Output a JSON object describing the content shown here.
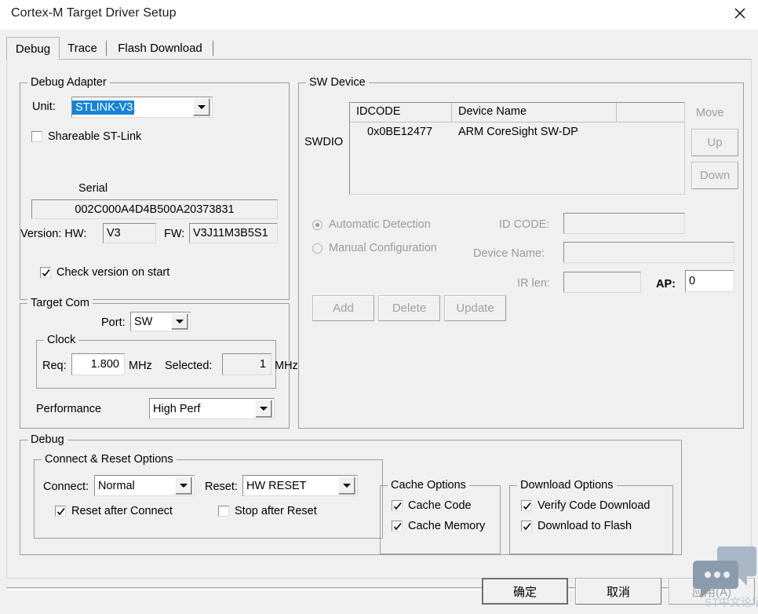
{
  "window": {
    "title": "Cortex-M Target Driver Setup",
    "close_icon": "close-icon"
  },
  "tabs": [
    {
      "label": "Debug",
      "active": true
    },
    {
      "label": "Trace",
      "active": false
    },
    {
      "label": "Flash Download",
      "active": false
    }
  ],
  "debug_adapter": {
    "legend": "Debug Adapter",
    "unit_label": "Unit:",
    "unit_value": "STLINK-V3",
    "unit_selected": true,
    "shareable_label": "Shareable ST-Link",
    "shareable_checked": false,
    "serial_label": "Serial",
    "serial_value": "002C000A4D4B500A20373831",
    "version_label": "Version: HW:",
    "hw_value": "V3",
    "fw_label": "FW:",
    "fw_value": "V3J11M3B5S1",
    "check_version_label": "Check version on start",
    "check_version_checked": true
  },
  "target_com": {
    "legend": "Target Com",
    "port_label": "Port:",
    "port_value": "SW",
    "clock_legend": "Clock",
    "req_label": "Req:",
    "req_value": "1.800",
    "req_unit": "MHz",
    "selected_label": "Selected:",
    "selected_value": "1",
    "selected_unit": "MHz",
    "performance_label": "Performance",
    "performance_value": "High Perf"
  },
  "sw_device": {
    "legend": "SW Device",
    "swdio_label": "SWDIO",
    "columns": [
      "IDCODE",
      "Device Name",
      ""
    ],
    "rows": [
      {
        "idcode": "0x0BE12477",
        "device_name": "ARM CoreSight SW-DP",
        "extra": ""
      }
    ],
    "move_label": "Move",
    "up_label": "Up",
    "down_label": "Down",
    "up_enabled": false,
    "down_enabled": false,
    "automatic_detection_label": "Automatic Detection",
    "automatic_detection_selected": true,
    "manual_configuration_label": "Manual Configuration",
    "manual_configuration_selected": false,
    "id_code_label": "ID CODE:",
    "id_code_value": "",
    "device_name_label": "Device Name:",
    "device_name_value": "",
    "ir_len_label": "IR len:",
    "ir_len_value": "",
    "ap_label": "AP:",
    "ap_value": "0",
    "add_label": "Add",
    "delete_label": "Delete",
    "update_label": "Update"
  },
  "debug_section": {
    "legend": "Debug",
    "connect_reset": {
      "legend": "Connect & Reset Options",
      "connect_label": "Connect:",
      "connect_value": "Normal",
      "reset_label": "Reset:",
      "reset_value": "HW RESET",
      "reset_after_connect_label": "Reset after Connect",
      "reset_after_connect_checked": true,
      "stop_after_reset_label": "Stop after Reset",
      "stop_after_reset_checked": false
    },
    "cache_options": {
      "legend": "Cache Options",
      "cache_code_label": "Cache Code",
      "cache_code_checked": true,
      "cache_memory_label": "Cache Memory",
      "cache_memory_checked": true
    },
    "download_options": {
      "legend": "Download Options",
      "verify_code_download_label": "Verify Code Download",
      "verify_code_download_checked": true,
      "download_to_flash_label": "Download to Flash",
      "download_to_flash_checked": true
    }
  },
  "footer": {
    "ok_label": "确定",
    "cancel_label": "取消",
    "apply_label": "应用(A)",
    "apply_enabled": false
  },
  "watermark": {
    "text": "ST中文论坛",
    "icon": "chat-bubbles-icon",
    "color": "#b9c6d4"
  },
  "colors": {
    "dialog_bg": "#f0f0f0",
    "titlebar_bg": "#ffffff",
    "selection_blue": "#1683d8",
    "group_border": "#9d9d9d",
    "disabled_text": "#9a9a9a"
  }
}
